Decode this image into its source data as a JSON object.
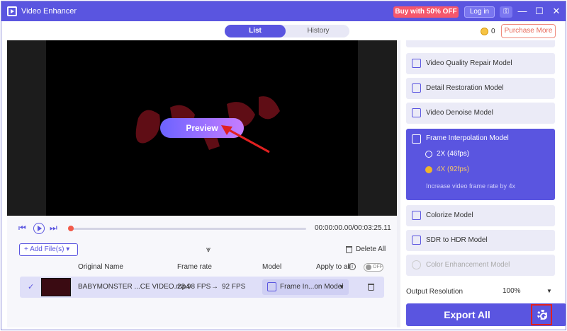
{
  "window": {
    "title": "Video Enhancer",
    "promo_label": "Buy with 50% OFF",
    "login_label": "Log in",
    "minimize": "—",
    "maximize": "☐",
    "close": "✕"
  },
  "tabs": [
    {
      "label": "List",
      "active": true
    },
    {
      "label": "History",
      "active": false
    }
  ],
  "credits": {
    "count": "0",
    "purchase_label": "Purchase More"
  },
  "preview": {
    "button_label": "Preview"
  },
  "player": {
    "time": "00:00:00.00/00:03:25.11",
    "progress": 0
  },
  "list_toolbar": {
    "add_files_label": "Add File(s)",
    "delete_all_label": "Delete All"
  },
  "columns": {
    "name": "Original Name",
    "rate": "Frame rate",
    "model": "Model",
    "apply_all": "Apply to all",
    "apply_all_toggle": "OFF"
  },
  "files": [
    {
      "name": "BABYMONSTER ...CE VIDEO.mp4",
      "rate_from": "23.98 FPS",
      "rate_to": "92 FPS",
      "model": "Frame In...on Model",
      "checked": true
    }
  ],
  "models": [
    {
      "label": "Video Quality Repair Model",
      "icon": "video-repair-icon"
    },
    {
      "label": "Detail Restoration Model",
      "icon": "detail-restore-icon"
    },
    {
      "label": "Video Denoise Model",
      "icon": "denoise-icon"
    },
    {
      "label": "Frame Interpolation Model",
      "icon": "frame-interpolation-icon",
      "selected": true
    },
    {
      "label": "Colorize Model",
      "icon": "colorize-icon"
    },
    {
      "label": "SDR to HDR Model",
      "icon": "hdr-icon"
    },
    {
      "label": "Color Enhancement Model",
      "icon": "color-enhance-icon",
      "disabled": true
    }
  ],
  "interpolation_options": [
    {
      "label": "2X (46fps)",
      "selected": false
    },
    {
      "label": "4X (92fps)",
      "selected": true
    }
  ],
  "interpolation_hint": "Increase video frame rate by 4x",
  "output": {
    "label": "Output Resolution",
    "value": "100%"
  },
  "export_label": "Export All",
  "colors": {
    "accent": "#5a55e0",
    "promo": "#f5576c",
    "progress_knob": "#f25a4a",
    "highlight_box": "#e02020"
  }
}
